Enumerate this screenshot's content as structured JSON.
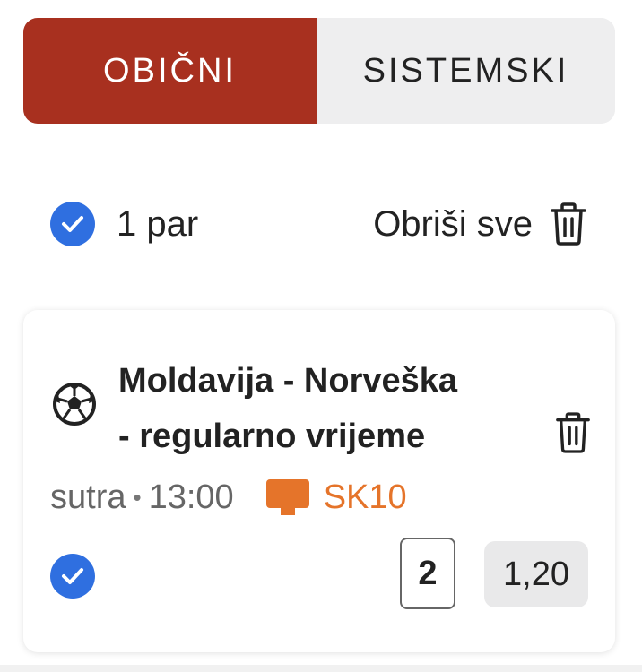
{
  "tabs": [
    {
      "label": "OBIČNI",
      "active": true
    },
    {
      "label": "SISTEMSKI",
      "active": false
    }
  ],
  "summary": {
    "pair_count": "1 par",
    "delete_all_label": "Obriši sve"
  },
  "bet": {
    "title_line1": "Moldavija - Norveška",
    "title_line2": "- regularno vrijeme",
    "day": "sutra",
    "time": "13:00",
    "tv_channel": "SK10",
    "selection": "2",
    "odds": "1,20",
    "sport_icon": "soccer-ball-icon"
  },
  "colors": {
    "accent_red": "#a8301f",
    "check_blue": "#2f6fe0",
    "tv_orange": "#e5742a",
    "inactive_tab": "#eeeeef"
  }
}
